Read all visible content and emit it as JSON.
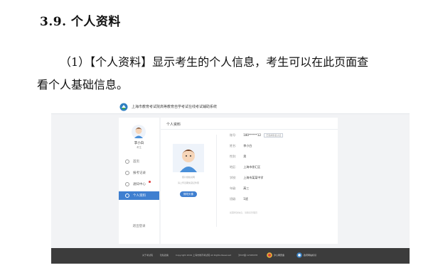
{
  "heading": "3.9. 个人资料",
  "paragraph": {
    "line1": "（1）【个人资料】显示考生的个人信息，考生可以在此页面查",
    "line2": "看个人基础信息。"
  },
  "screenshot": {
    "system_name": "上海市教育考试院高等教育自学考试在线考试辅助系统",
    "sidebar": {
      "name": "李小白",
      "sub": "考生",
      "menu": [
        {
          "label": "首页",
          "icon": "home-icon"
        },
        {
          "label": "报考记录",
          "icon": "record-icon"
        },
        {
          "label": "通知中心",
          "icon": "bell-icon"
        },
        {
          "label": "个人资料",
          "icon": "user-icon",
          "active": true
        }
      ],
      "logout": "退出登录"
    },
    "main": {
      "title": "个人资料",
      "photo_hint": "照片规格说明",
      "photo_hint2": "请上传近期免冠证件照",
      "upload_button": "修改头像",
      "fields": [
        {
          "label": "账号:",
          "value": "180******12",
          "tag": "已完成实名认证"
        },
        {
          "label": "姓名:",
          "value": "李小白"
        },
        {
          "label": "性别:",
          "value": "男"
        },
        {
          "label": "地区:",
          "value": "上海市徐汇区"
        },
        {
          "label": "学校:",
          "value": "上海市某某中学"
        },
        {
          "label": "年级:",
          "value": "高三"
        },
        {
          "label": "班级:",
          "value": "1班"
        }
      ],
      "note": "如需修改信息，请联系管理员"
    },
    "footer": {
      "links": [
        "关于考试院",
        "隐私政策",
        "Copyright 2019 上海市教育考试院 All Rights Reserved",
        "沪ICP备 12345678"
      ],
      "badge1": "沪公网安备",
      "badge2": "政府网站标识"
    }
  }
}
